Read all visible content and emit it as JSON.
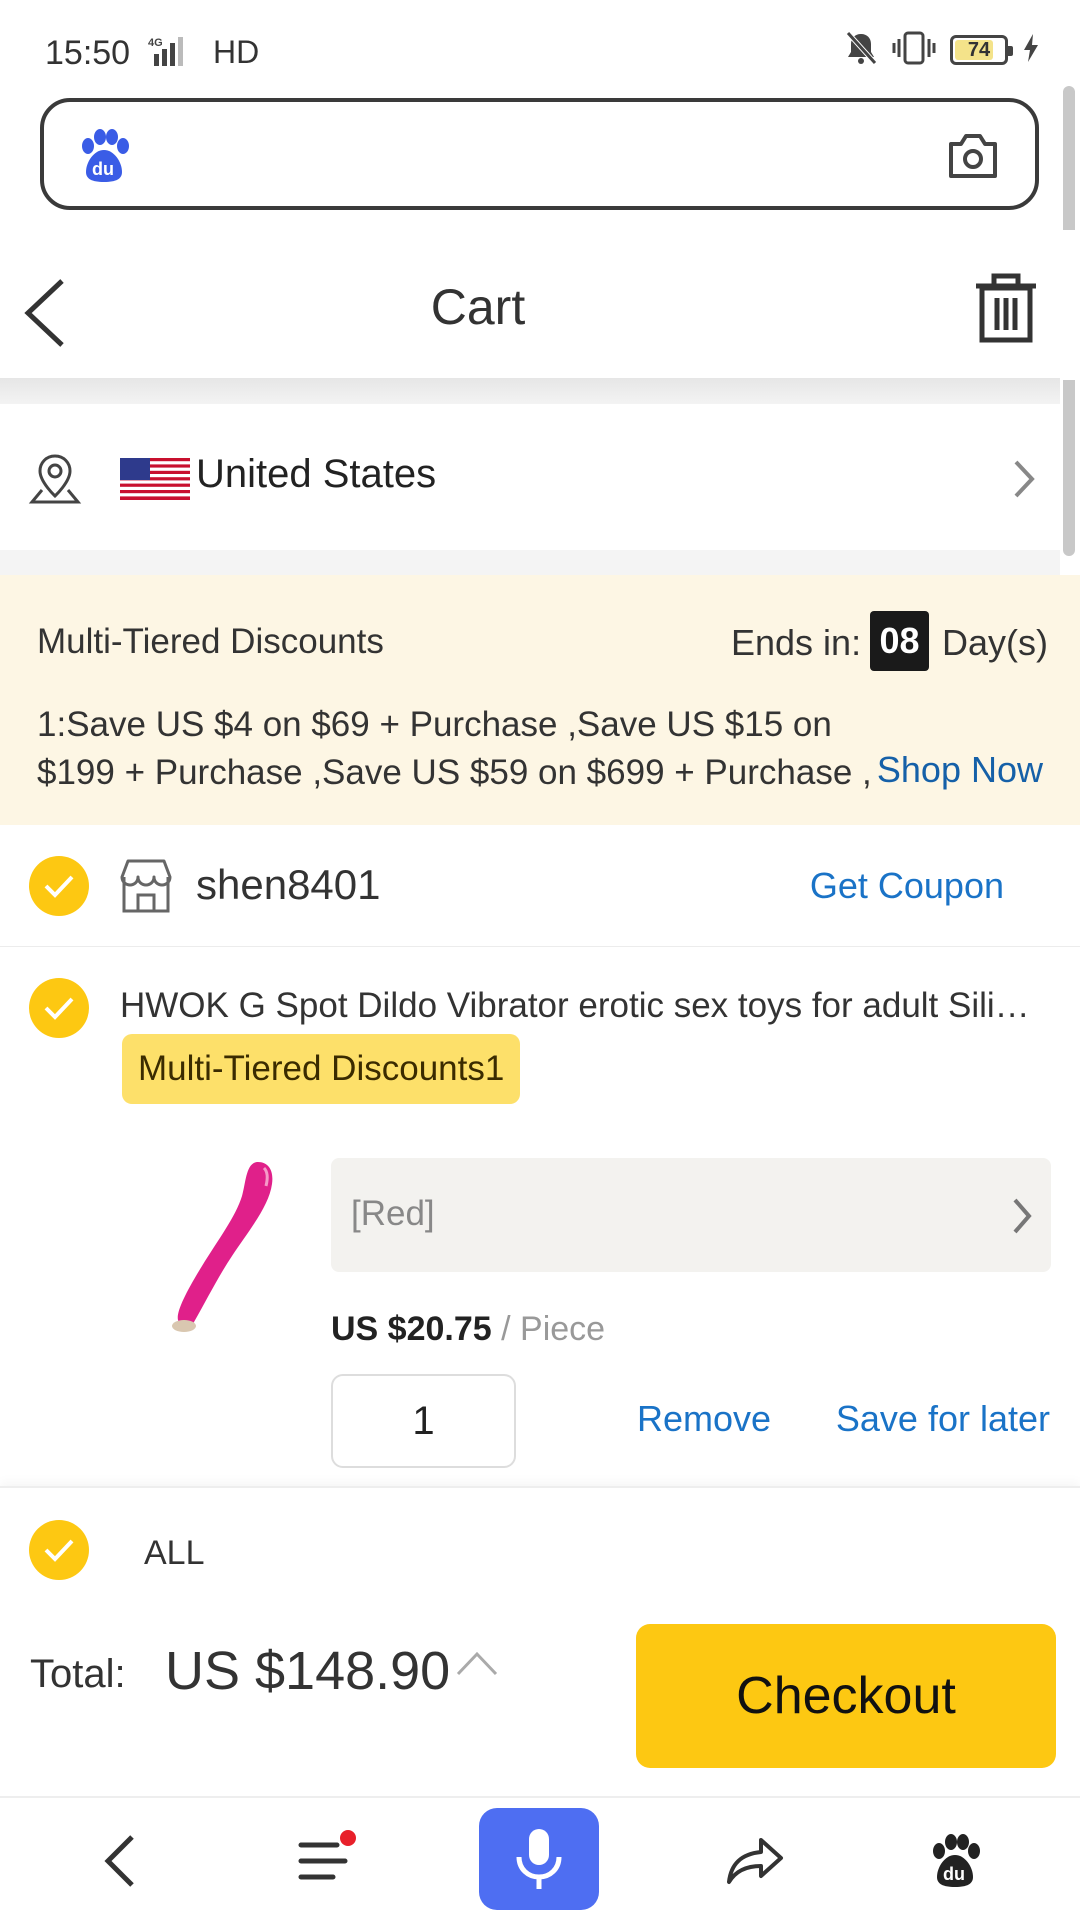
{
  "status_bar": {
    "time": "15:50",
    "network_label": "HD",
    "signal_label": "4G",
    "battery_level": "74"
  },
  "search_bar": {
    "placeholder": ""
  },
  "header": {
    "title": "Cart"
  },
  "location": {
    "country": "United States"
  },
  "promo": {
    "title": "Multi-Tiered Discounts",
    "ends_label": "Ends in:",
    "ends_value": "08",
    "ends_unit": "Day(s)",
    "description": "1:Save US $4 on $69 + Purchase ,Save US $15 on $199 + Purchase ,Save US $59 on $699 + Purchase ,",
    "shop_now_label": "Shop Now"
  },
  "store": {
    "name": "shen8401",
    "coupon_label": "Get Coupon"
  },
  "item": {
    "title": "HWOK G Spot Dildo Vibrator erotic sex toys for adult Sili…",
    "badge": "Multi-Tiered Discounts1",
    "variant": "[Red]",
    "price": "US $20.75",
    "price_unit": "/ Piece",
    "quantity": "1",
    "remove_label": "Remove",
    "save_later_label": "Save for later"
  },
  "footer": {
    "all_label": "ALL",
    "total_label": "Total:",
    "total_value": "US $148.90",
    "checkout_label": "Checkout"
  },
  "colors": {
    "accent_yellow": "#fdc812",
    "link_blue": "#1a73c7",
    "promo_bg": "#fdf6e4",
    "mic_blue": "#4e6ef2"
  }
}
